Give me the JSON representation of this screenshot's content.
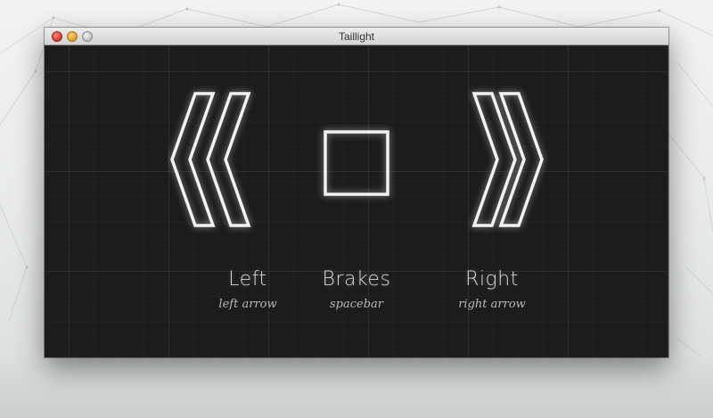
{
  "window": {
    "title": "Taillight"
  },
  "signals": {
    "left": {
      "label": "Left",
      "key": "left arrow",
      "icon": "double-chevron-left-icon"
    },
    "brakes": {
      "label": "Brakes",
      "key": "spacebar",
      "icon": "square-icon"
    },
    "right": {
      "label": "Right",
      "key": "right arrow",
      "icon": "double-chevron-right-icon"
    }
  }
}
